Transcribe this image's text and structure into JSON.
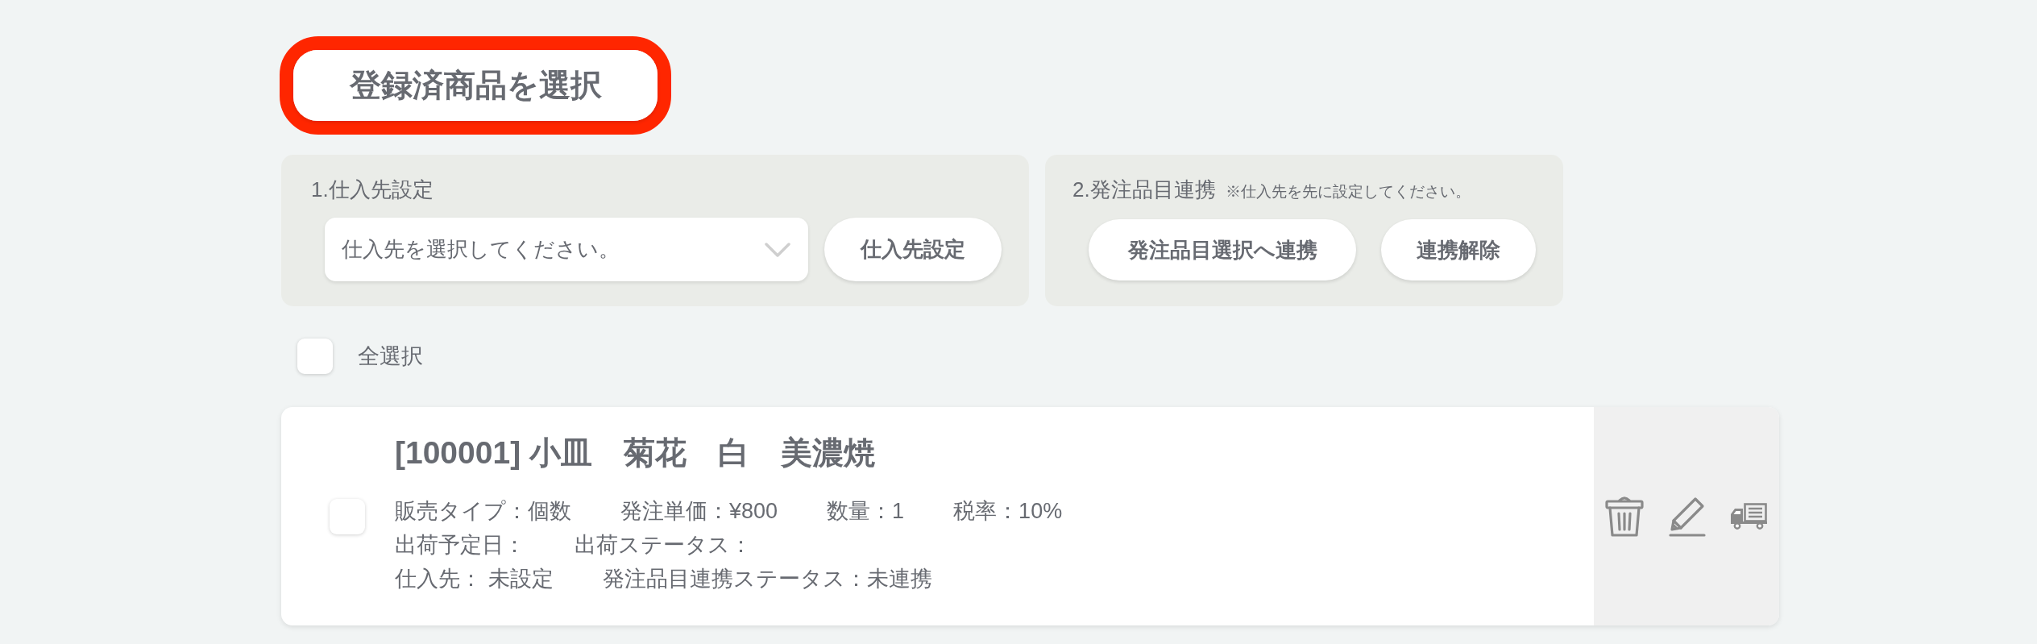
{
  "register_button": {
    "label": "登録済商品を選択",
    "highlighted": true
  },
  "supplier_panel": {
    "title": "1.仕入先設定",
    "select": {
      "placeholder": "仕入先を選択してください。"
    },
    "button": "仕入先設定"
  },
  "order_link_panel": {
    "title": "2.発注品目連携",
    "note": "※仕入先を先に設定してください。",
    "buttons": [
      "発注品目選択へ連携",
      "連携解除"
    ]
  },
  "select_all": {
    "label": "全選択",
    "checked": false
  },
  "items": [
    {
      "title": "[100001] 小皿　菊花　白　美濃焼",
      "checked": false,
      "detail_lines": [
        [
          "販売タイプ：個数",
          "発注単価：¥800",
          "数量：1",
          "税率：10%"
        ],
        [
          "出荷予定日：",
          "出荷ステータス："
        ],
        [
          "仕入先： 未設定",
          "発注品目連携ステータス：未連携"
        ]
      ]
    }
  ]
}
